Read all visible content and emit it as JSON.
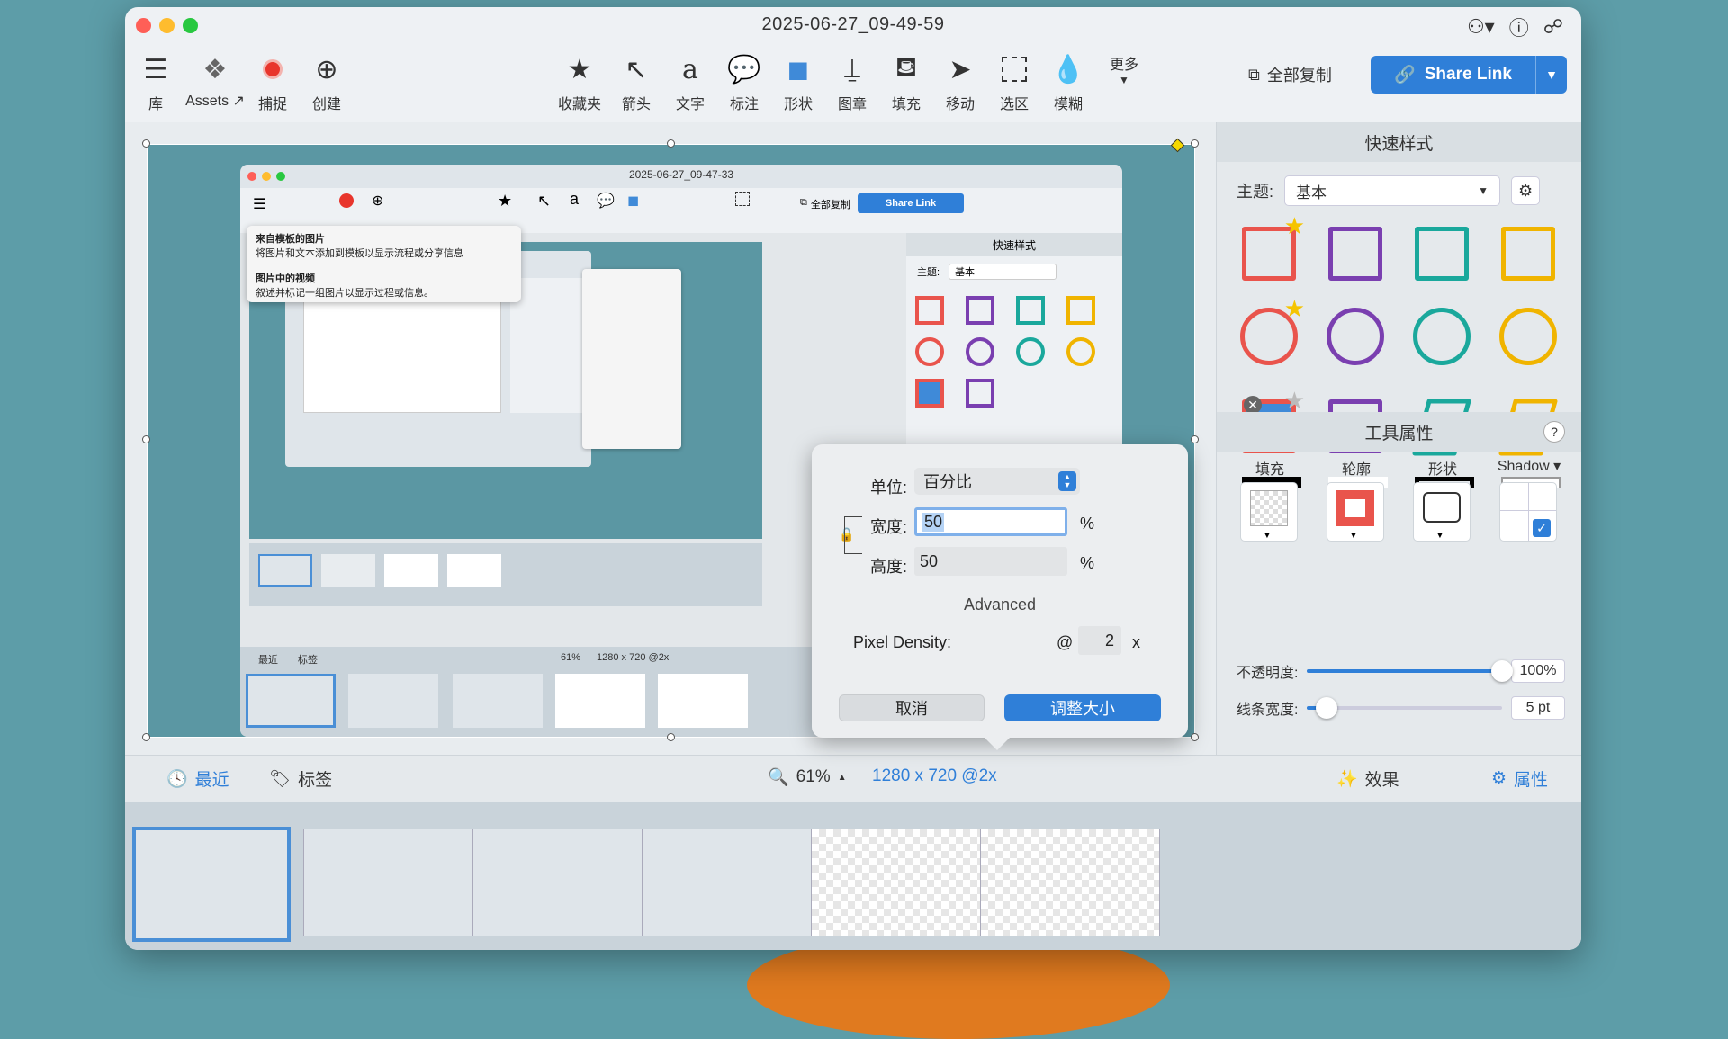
{
  "title": "2025-06-27_09-49-59",
  "toolbar": {
    "library": "库",
    "assets": "Assets ↗",
    "capture": "捕捉",
    "create": "创建",
    "favorites": "收藏夹",
    "arrow": "箭头",
    "text": "文字",
    "callout": "标注",
    "shape": "形状",
    "stamp": "图章",
    "fill": "填充",
    "move": "移动",
    "select": "选区",
    "blur": "模糊",
    "more": "更多",
    "copy_all": "全部复制",
    "share_link": "Share Link"
  },
  "inner": {
    "title": "2025-06-27_09-47-33",
    "menu": [
      {
        "title": "来自模板的图片",
        "desc": "将图片和文本添加到模板以显示流程或分享信息"
      },
      {
        "title": "图片中的视频",
        "desc": "叙述并标记一组图片以显示过程或信息。"
      }
    ],
    "copy_all": "全部复制",
    "share_link": "Share Link",
    "quick_styles": "快速样式",
    "theme_label": "主题:",
    "theme_value": "基本",
    "recent": "最近",
    "tags": "标签",
    "zoom": "61%",
    "size": "1280 x 720 @2x"
  },
  "panel": {
    "quick_styles": "快速样式",
    "theme_label": "主题:",
    "theme_value": "基本",
    "tool_props": "工具属性",
    "help": "?",
    "fill": "填充",
    "outline": "轮廓",
    "shape": "形状",
    "shadow": "Shadow ▾",
    "opacity_label": "不透明度:",
    "opacity_value": "100%",
    "opacity_level": 1.0,
    "line_width_label": "线条宽度:",
    "line_width_value": "5 pt",
    "line_width_level": 0.1
  },
  "dialog": {
    "unit_label": "单位:",
    "unit_value": "百分比",
    "width_label": "宽度:",
    "width_value": "50",
    "height_label": "高度:",
    "height_value": "50",
    "percent": "%",
    "advanced": "Advanced",
    "pixel_density_label": "Pixel Density:",
    "at": "@",
    "pixel_density_value": "2",
    "x": "x",
    "cancel": "取消",
    "resize": "调整大小"
  },
  "bottombar": {
    "recent": "最近",
    "tags": "标签",
    "zoom": "61%",
    "size": "1280 x 720 @2x",
    "effects": "效果",
    "properties": "属性"
  },
  "colors": {
    "accent": "#2f7fd8",
    "red": "#e9544c",
    "purple": "#7a3fb0",
    "teal": "#1aa89c",
    "yellow": "#f0b400"
  }
}
